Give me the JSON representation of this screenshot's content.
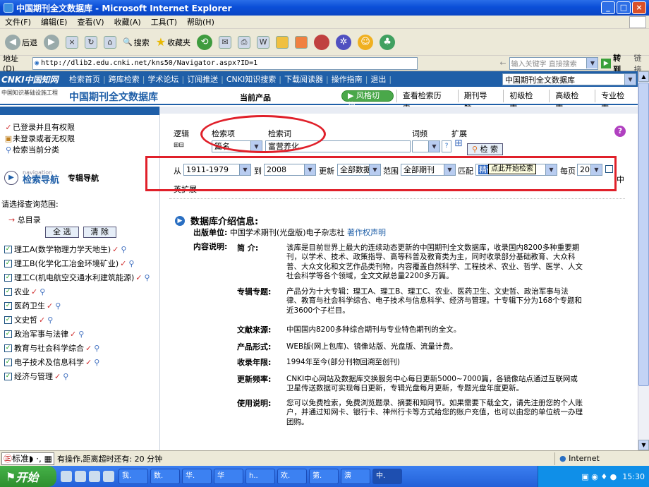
{
  "window": {
    "title": "中国期刊全文数据库 - Microsoft Internet Explorer"
  },
  "menu": [
    "文件(F)",
    "编辑(E)",
    "查看(V)",
    "收藏(A)",
    "工具(T)",
    "帮助(H)"
  ],
  "toolbar": {
    "back": "后退",
    "search": "搜索",
    "favorites": "收藏夹"
  },
  "address": {
    "label": "地址(D)",
    "url": "http://dlib2.edu.cnki.net/kns50/Navigator.aspx?ID=1",
    "search_placeholder": "输入关键字 直接搜索",
    "go": "转到",
    "links": "链接"
  },
  "cnki": {
    "logo": "CNKI中国知网",
    "sublogo": "中国知识基础设施工程",
    "links": [
      "检索首页",
      "跨库检索",
      "学术论坛",
      "订阅推送",
      "CNKI知识搜索",
      "下载阅读器",
      "操作指南",
      "退出"
    ],
    "db_select": "中国期刊全文数据库"
  },
  "header": {
    "dbname": "中国期刊全文数据库",
    "current_product": "当前产品",
    "style_switch": "风格切换",
    "tabs": [
      "查看检索历史",
      "期刊导航",
      "初级检索",
      "高级检索",
      "专业检索"
    ]
  },
  "legend": [
    "已登录并且有权限",
    "未登录或者无权限",
    "检索当前分类"
  ],
  "nav": {
    "small": "navigation",
    "big": "检索导航",
    "special": "专辑导航"
  },
  "scope": {
    "label": "请选择查询范围:",
    "total": "总目录",
    "select_all": "全 选",
    "clear": "清 除"
  },
  "categories": [
    "理工A(数学物理力学天地生)",
    "理工B(化学化工冶金环境矿业)",
    "理工C(机电航空交通水利建筑能源)",
    "农业",
    "医药卫生",
    "文史哲",
    "政治军事与法律",
    "教育与社会科学综合",
    "电子技术及信息科学",
    "经济与管理"
  ],
  "search": {
    "logic": "逻辑",
    "field": "检索项",
    "term": "检索词",
    "freq": "词频",
    "expand": "扩展",
    "field_value": "篇名",
    "term_value": "富营养化",
    "search_btn": "检 索"
  },
  "range": {
    "from": "从",
    "from_year": "1911-1979",
    "to": "到",
    "to_year": "2008",
    "update": "更新",
    "update_value": "全部数据",
    "scope": "范围",
    "scope_value": "全部期刊",
    "match": "匹配",
    "match_value": "精确",
    "per_page": "每页",
    "per_page_value": "20",
    "cn_expand": "中英扩展",
    "tooltip": "点此开始检索"
  },
  "intro": {
    "title": "数据库介绍信息:",
    "publisher_label": "出版单位:",
    "publisher": "中国学术期刊(光盘版)电子杂志社",
    "copyright": "著作权声明",
    "content_label": "内容说明:",
    "items": [
      {
        "label": "简 介:",
        "text": "该库是目前世界上最大的连续动态更新的中国期刊全文数据库，收录国内8200多种重要期刊，以学术、技术、政策指导、高等科普及教育类为主，同时收录部分基础教育、大众科普、大众文化和文艺作品类刊物，内容覆盖自然科学、工程技术、农业、哲学、医学、人文社会科学等各个领域，全文文献总量2200多万篇。"
      },
      {
        "label": "专辑专题:",
        "text": "产品分为十大专辑：理工A、理工B、理工C、农业、医药卫生、文史哲、政治军事与法律、教育与社会科学综合、电子技术与信息科学、经济与管理。十专辑下分为168个专题和近3600个子栏目。"
      },
      {
        "label": "文献来源:",
        "text": "中国国内8200多种综合期刊与专业特色期刊的全文。"
      },
      {
        "label": "产品形式:",
        "text": "WEB版(网上包库)、镜像站版、光盘版、流量计费。"
      },
      {
        "label": "收录年限:",
        "text": "1994年至今(部分刊物回溯至创刊)"
      },
      {
        "label": "更新频率:",
        "text": "CNKI中心网站及数据库交换服务中心每日更新5000~7000篇，各镜像站点通过互联网或卫星传送数据可实现每日更新，专辑光盘每月更新，专题光盘年度更新。"
      },
      {
        "label": "使用说明:",
        "text": "您可以免费检索，免费浏览题录、摘要和知网节。如果需要下载全文，请先注册您的个人账户，并通过知网卡、银行卡、神州行卡等方式给您的账户充值，也可以由您的单位统一办理团购。"
      }
    ]
  },
  "status": {
    "ime": "标准",
    "text": "有操作,距离超时还有: 20 分钟",
    "zone": "Internet"
  },
  "taskbar": {
    "start": "开始",
    "tasks": [
      "我.",
      "数.",
      "华.",
      "华",
      "h..",
      "欢.",
      "第.",
      "演",
      "中."
    ],
    "clock": "15:30"
  }
}
